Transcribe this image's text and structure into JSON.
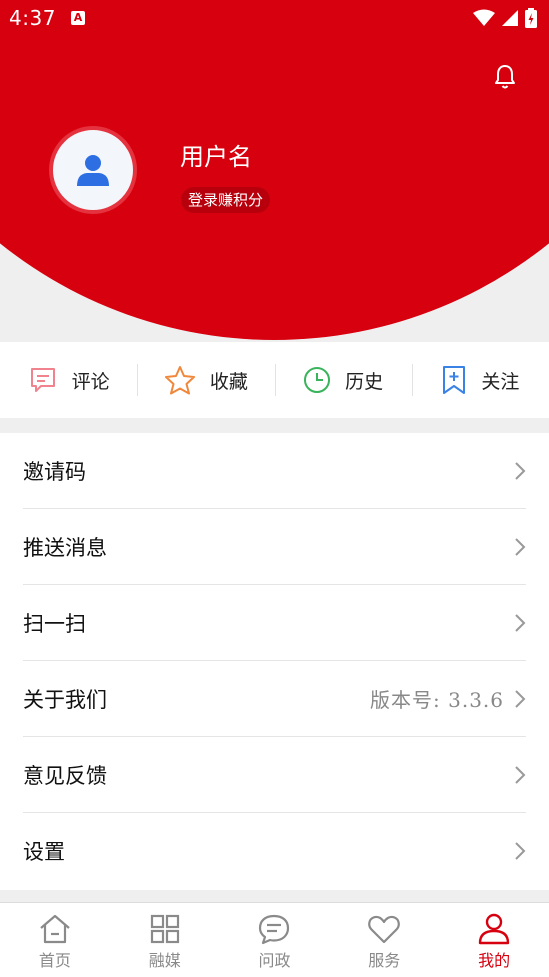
{
  "status_bar": {
    "time": "4:37",
    "notification_glyph": "A"
  },
  "header": {
    "username": "用户名",
    "login_button": "登录赚积分"
  },
  "quick_actions": [
    {
      "label": "评论",
      "icon": "comment-icon",
      "color": "#f0838e"
    },
    {
      "label": "收藏",
      "icon": "star-icon",
      "color": "#f0873a"
    },
    {
      "label": "历史",
      "icon": "clock-icon",
      "color": "#39b35c"
    },
    {
      "label": "关注",
      "icon": "bookmark-plus-icon",
      "color": "#3b82e6"
    }
  ],
  "menu": [
    {
      "label": "邀请码",
      "value": ""
    },
    {
      "label": "推送消息",
      "value": ""
    },
    {
      "label": "扫一扫",
      "value": ""
    },
    {
      "label": "关于我们",
      "value": "版本号: 3.3.6"
    },
    {
      "label": "意见反馈",
      "value": ""
    },
    {
      "label": "设置",
      "value": ""
    }
  ],
  "bottom_nav": [
    {
      "label": "首页",
      "icon": "home-icon",
      "active": false
    },
    {
      "label": "融媒",
      "icon": "grid-icon",
      "active": false
    },
    {
      "label": "问政",
      "icon": "chat-icon",
      "active": false
    },
    {
      "label": "服务",
      "icon": "heart-icon",
      "active": false
    },
    {
      "label": "我的",
      "icon": "person-icon",
      "active": true
    }
  ],
  "colors": {
    "brand_red": "#d7000f",
    "background": "#efefef",
    "avatar_blue": "#2d6fe3"
  }
}
